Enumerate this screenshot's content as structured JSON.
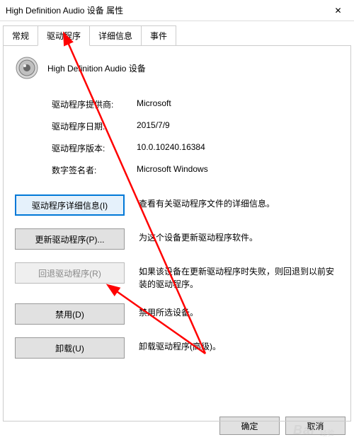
{
  "window": {
    "title": "High Definition Audio 设备 属性",
    "close_glyph": "✕"
  },
  "tabs": {
    "general": "常规",
    "driver": "驱动程序",
    "details": "详细信息",
    "events": "事件"
  },
  "device": {
    "name": "High Definition Audio 设备"
  },
  "info": {
    "provider_label": "驱动程序提供商:",
    "provider_value": "Microsoft",
    "date_label": "驱动程序日期:",
    "date_value": "2015/7/9",
    "version_label": "驱动程序版本:",
    "version_value": "10.0.10240.16384",
    "signer_label": "数字签名者:",
    "signer_value": "Microsoft Windows"
  },
  "actions": {
    "details_btn": "驱动程序详细信息(I)",
    "details_desc": "查看有关驱动程序文件的详细信息。",
    "update_btn": "更新驱动程序(P)...",
    "update_desc": "为这个设备更新驱动程序软件。",
    "rollback_btn": "回退驱动程序(R)",
    "rollback_desc": "如果该设备在更新驱动程序时失败，则回退到以前安装的驱动程序。",
    "disable_btn": "禁用(D)",
    "disable_desc": "禁用所选设备。",
    "uninstall_btn": "卸载(U)",
    "uninstall_desc": "卸载驱动程序(高级)。"
  },
  "footer": {
    "ok": "确定",
    "cancel": "取消"
  },
  "watermark": {
    "main": "Bai",
    "sub": "经验"
  }
}
